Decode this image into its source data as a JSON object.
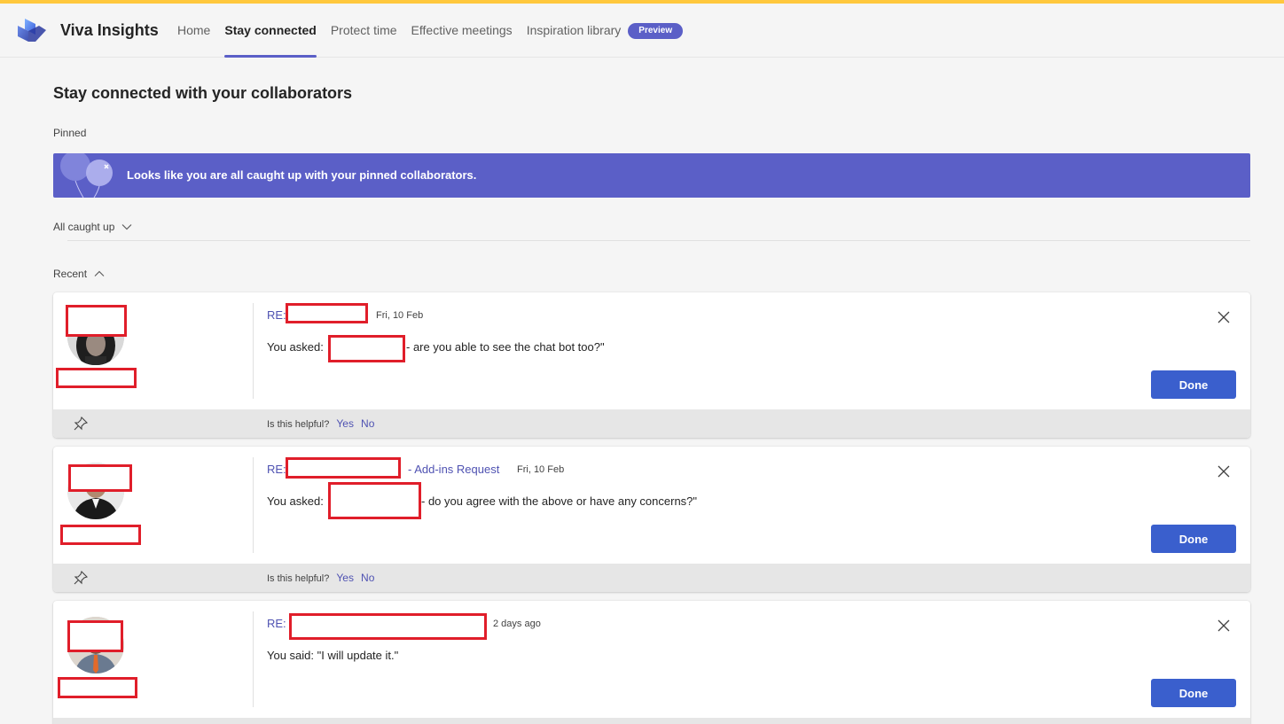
{
  "app": {
    "title": "Viva Insights",
    "accent_color": "#ffc83d",
    "brand_color": "#5b5fc7"
  },
  "nav": {
    "items": [
      {
        "label": "Home",
        "active": false
      },
      {
        "label": "Stay connected",
        "active": true
      },
      {
        "label": "Protect time",
        "active": false
      },
      {
        "label": "Effective meetings",
        "active": false
      },
      {
        "label": "Inspiration library",
        "active": false
      }
    ],
    "preview_badge": "Preview"
  },
  "page": {
    "title": "Stay connected with your collaborators",
    "pinned_label": "Pinned",
    "banner_text": "Looks like you are all caught up with your pinned collaborators.",
    "caught_up_toggle": "All caught up",
    "recent_toggle": "Recent"
  },
  "cards": [
    {
      "subject_prefix": "RE:",
      "subject_suffix": "",
      "date": "Fri, 10 Feb",
      "message_prefix": "You asked:",
      "message_suffix": "-  are you able to see the chat bot too?\"",
      "done_label": "Done",
      "helpful_question": "Is this helpful?",
      "yes_label": "Yes",
      "no_label": "No",
      "avatar_icon": "person-avatar-dark-hair"
    },
    {
      "subject_prefix": "RE:",
      "subject_suffix": "- Add-ins Request",
      "date": "Fri, 10 Feb",
      "message_prefix": "You asked:",
      "message_suffix": "- do you agree with the above or have any concerns?\"",
      "done_label": "Done",
      "helpful_question": "Is this helpful?",
      "yes_label": "Yes",
      "no_label": "No",
      "avatar_icon": "person-avatar-suit"
    },
    {
      "subject_prefix": "RE: K",
      "subject_suffix": "",
      "date": "2 days ago",
      "message_prefix": "You said: \"I will update it.\"",
      "message_suffix": "",
      "done_label": "Done",
      "avatar_icon": "person-avatar-tie"
    }
  ]
}
